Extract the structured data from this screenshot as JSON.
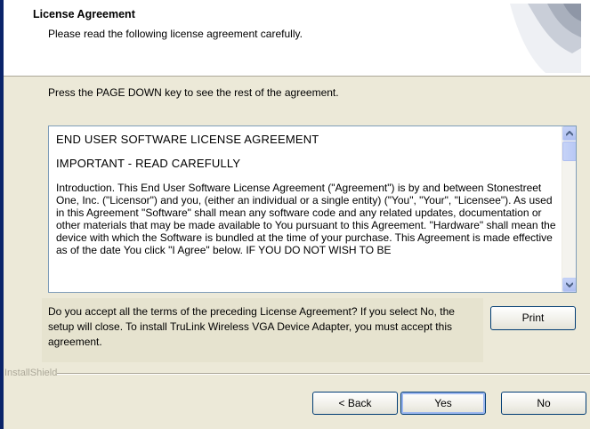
{
  "header": {
    "title": "License Agreement",
    "subtitle": "Please read the following license agreement carefully."
  },
  "instruction": "Press the PAGE DOWN key to see the rest of the agreement.",
  "license": {
    "heading": "END USER SOFTWARE LICENSE AGREEMENT",
    "important": "IMPORTANT - READ CAREFULLY",
    "body": "Introduction.  This End User Software License Agreement (\"Agreement\") is by and between Stonestreet One, Inc. (\"Licensor\") and you, (either an individual or a single entity) (\"You\", \"Your\", \"Licensee\").  As used in this Agreement \"Software\" shall mean any software code and any related updates, documentation or other materials that may be made available to You pursuant to this Agreement.  \"Hardware\" shall mean the device with which the Software is bundled at the time of your purchase.  This Agreement is made effective as of the date You click \"I Agree\" below.  IF YOU DO NOT WISH TO BE"
  },
  "question": "Do you accept all the terms of the preceding License Agreement?  If you select No, the setup will close.  To install TruLink Wireless VGA Device Adapter, you must accept this agreement.",
  "buttons": {
    "print": "Print",
    "back": "< Back",
    "yes": "Yes",
    "no": "No"
  },
  "footer_brand": "InstallShield",
  "colors": {
    "dialog_bg": "#ece9d8",
    "accent": "#0a246a",
    "button_border": "#003c74"
  }
}
